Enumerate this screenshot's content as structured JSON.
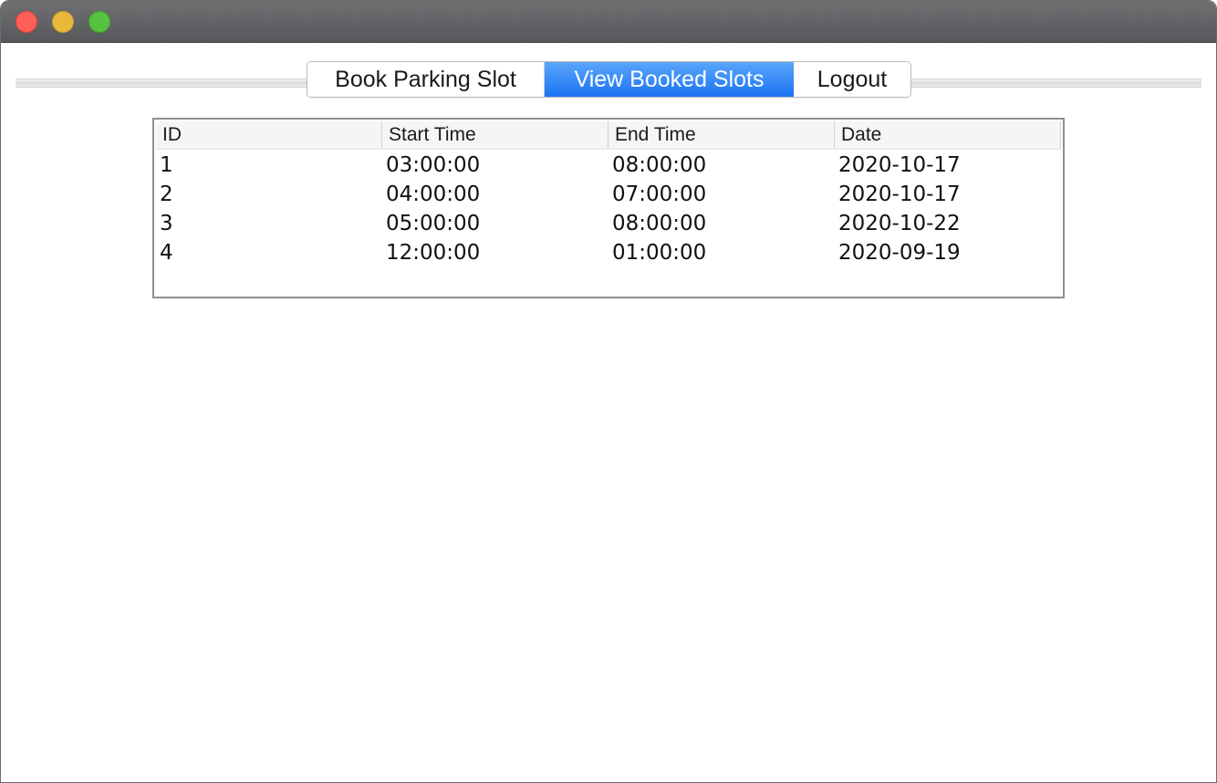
{
  "window": {
    "title": ""
  },
  "tabs": [
    {
      "label": "Book Parking Slot",
      "selected": false
    },
    {
      "label": "View Booked Slots",
      "selected": true
    },
    {
      "label": "Logout",
      "selected": false
    }
  ],
  "table": {
    "columns": [
      "ID",
      "Start Time",
      "End Time",
      "Date"
    ],
    "rows": [
      [
        "1",
        "03:00:00",
        "08:00:00",
        "2020-10-17"
      ],
      [
        "2",
        "04:00:00",
        "07:00:00",
        "2020-10-17"
      ],
      [
        "3",
        "05:00:00",
        "08:00:00",
        "2020-10-22"
      ],
      [
        "4",
        "12:00:00",
        "01:00:00",
        "2020-09-19"
      ]
    ]
  },
  "colors": {
    "selected_tab": "#1b73f3",
    "close_button": "#fe5f57",
    "minimize_button": "#e9b83a",
    "maximize_button": "#58c13f"
  }
}
